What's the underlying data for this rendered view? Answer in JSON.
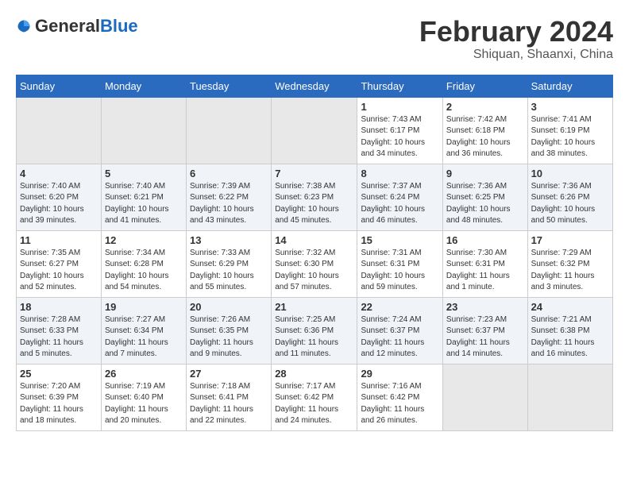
{
  "header": {
    "logo_general": "General",
    "logo_blue": "Blue",
    "month_year": "February 2024",
    "location": "Shiquan, Shaanxi, China"
  },
  "days_of_week": [
    "Sunday",
    "Monday",
    "Tuesday",
    "Wednesday",
    "Thursday",
    "Friday",
    "Saturday"
  ],
  "weeks": [
    [
      {
        "day": "",
        "empty": true
      },
      {
        "day": "",
        "empty": true
      },
      {
        "day": "",
        "empty": true
      },
      {
        "day": "",
        "empty": true
      },
      {
        "day": "1",
        "sunrise": "7:43 AM",
        "sunset": "6:17 PM",
        "daylight": "10 hours and 34 minutes."
      },
      {
        "day": "2",
        "sunrise": "7:42 AM",
        "sunset": "6:18 PM",
        "daylight": "10 hours and 36 minutes."
      },
      {
        "day": "3",
        "sunrise": "7:41 AM",
        "sunset": "6:19 PM",
        "daylight": "10 hours and 38 minutes."
      }
    ],
    [
      {
        "day": "4",
        "sunrise": "7:40 AM",
        "sunset": "6:20 PM",
        "daylight": "10 hours and 39 minutes."
      },
      {
        "day": "5",
        "sunrise": "7:40 AM",
        "sunset": "6:21 PM",
        "daylight": "10 hours and 41 minutes."
      },
      {
        "day": "6",
        "sunrise": "7:39 AM",
        "sunset": "6:22 PM",
        "daylight": "10 hours and 43 minutes."
      },
      {
        "day": "7",
        "sunrise": "7:38 AM",
        "sunset": "6:23 PM",
        "daylight": "10 hours and 45 minutes."
      },
      {
        "day": "8",
        "sunrise": "7:37 AM",
        "sunset": "6:24 PM",
        "daylight": "10 hours and 46 minutes."
      },
      {
        "day": "9",
        "sunrise": "7:36 AM",
        "sunset": "6:25 PM",
        "daylight": "10 hours and 48 minutes."
      },
      {
        "day": "10",
        "sunrise": "7:36 AM",
        "sunset": "6:26 PM",
        "daylight": "10 hours and 50 minutes."
      }
    ],
    [
      {
        "day": "11",
        "sunrise": "7:35 AM",
        "sunset": "6:27 PM",
        "daylight": "10 hours and 52 minutes."
      },
      {
        "day": "12",
        "sunrise": "7:34 AM",
        "sunset": "6:28 PM",
        "daylight": "10 hours and 54 minutes."
      },
      {
        "day": "13",
        "sunrise": "7:33 AM",
        "sunset": "6:29 PM",
        "daylight": "10 hours and 55 minutes."
      },
      {
        "day": "14",
        "sunrise": "7:32 AM",
        "sunset": "6:30 PM",
        "daylight": "10 hours and 57 minutes."
      },
      {
        "day": "15",
        "sunrise": "7:31 AM",
        "sunset": "6:31 PM",
        "daylight": "10 hours and 59 minutes."
      },
      {
        "day": "16",
        "sunrise": "7:30 AM",
        "sunset": "6:31 PM",
        "daylight": "11 hours and 1 minute."
      },
      {
        "day": "17",
        "sunrise": "7:29 AM",
        "sunset": "6:32 PM",
        "daylight": "11 hours and 3 minutes."
      }
    ],
    [
      {
        "day": "18",
        "sunrise": "7:28 AM",
        "sunset": "6:33 PM",
        "daylight": "11 hours and 5 minutes."
      },
      {
        "day": "19",
        "sunrise": "7:27 AM",
        "sunset": "6:34 PM",
        "daylight": "11 hours and 7 minutes."
      },
      {
        "day": "20",
        "sunrise": "7:26 AM",
        "sunset": "6:35 PM",
        "daylight": "11 hours and 9 minutes."
      },
      {
        "day": "21",
        "sunrise": "7:25 AM",
        "sunset": "6:36 PM",
        "daylight": "11 hours and 11 minutes."
      },
      {
        "day": "22",
        "sunrise": "7:24 AM",
        "sunset": "6:37 PM",
        "daylight": "11 hours and 12 minutes."
      },
      {
        "day": "23",
        "sunrise": "7:23 AM",
        "sunset": "6:37 PM",
        "daylight": "11 hours and 14 minutes."
      },
      {
        "day": "24",
        "sunrise": "7:21 AM",
        "sunset": "6:38 PM",
        "daylight": "11 hours and 16 minutes."
      }
    ],
    [
      {
        "day": "25",
        "sunrise": "7:20 AM",
        "sunset": "6:39 PM",
        "daylight": "11 hours and 18 minutes."
      },
      {
        "day": "26",
        "sunrise": "7:19 AM",
        "sunset": "6:40 PM",
        "daylight": "11 hours and 20 minutes."
      },
      {
        "day": "27",
        "sunrise": "7:18 AM",
        "sunset": "6:41 PM",
        "daylight": "11 hours and 22 minutes."
      },
      {
        "day": "28",
        "sunrise": "7:17 AM",
        "sunset": "6:42 PM",
        "daylight": "11 hours and 24 minutes."
      },
      {
        "day": "29",
        "sunrise": "7:16 AM",
        "sunset": "6:42 PM",
        "daylight": "11 hours and 26 minutes."
      },
      {
        "day": "",
        "empty": true
      },
      {
        "day": "",
        "empty": true
      }
    ]
  ]
}
